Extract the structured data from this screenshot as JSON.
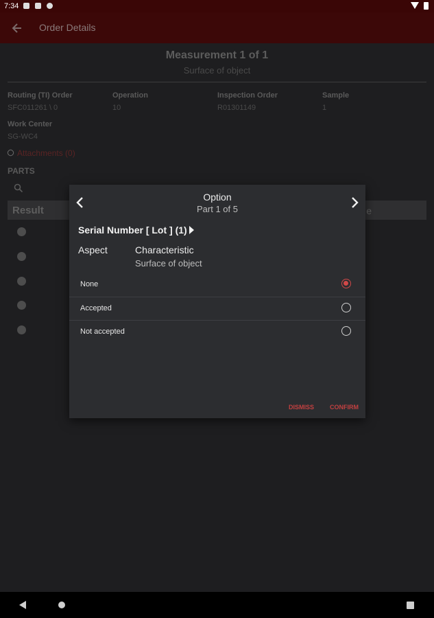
{
  "status_bar": {
    "time": "7:34"
  },
  "toolbar": {
    "title": "Order Details"
  },
  "measurement": {
    "title": "Measurement 1 of 1",
    "subtitle": "Surface of object"
  },
  "fields": [
    {
      "label": "Routing (TI) Order",
      "value": "SFC011261 \\ 0"
    },
    {
      "label": "Operation",
      "value": "10"
    },
    {
      "label": "Inspection Order",
      "value": "R01301149"
    },
    {
      "label": "Sample",
      "value": "1"
    },
    {
      "label": "Work Center",
      "value": "SG-WC4"
    }
  ],
  "attachments": {
    "label": "Attachments (0)"
  },
  "parts": {
    "label": "PARTS",
    "result_header": "Result",
    "right_header_fragment": "e"
  },
  "dialog": {
    "title": "Option",
    "subtitle": "Part 1 of 5",
    "serial": "Serial Number [ Lot ] (1)",
    "aspect_label": "Aspect",
    "characteristic_label": "Characteristic",
    "characteristic_value": "Surface of object",
    "options": [
      {
        "label": "None",
        "selected": true
      },
      {
        "label": "Accepted",
        "selected": false
      },
      {
        "label": "Not accepted",
        "selected": false
      }
    ],
    "dismiss": "DISMISS",
    "confirm": "CONFIRM"
  },
  "colors": {
    "toolbar": "#3c0808",
    "accent": "#d04848",
    "dialog_bg": "#2c2d30"
  }
}
